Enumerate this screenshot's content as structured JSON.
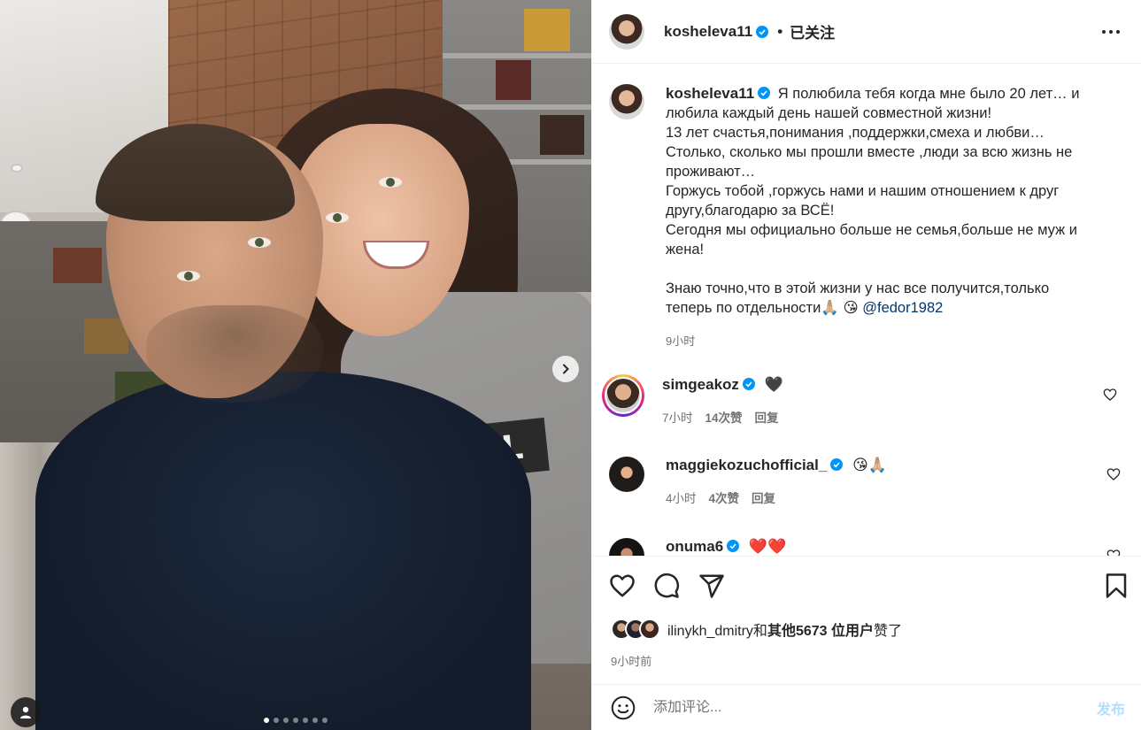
{
  "post": {
    "author": "kosheleva11",
    "follow_status": "已关注",
    "separator": "•",
    "carousel_count": 7,
    "carousel_active": 1
  },
  "caption": {
    "username": "kosheleva11",
    "lines": [
      "Я полюбила тебя когда мне было 20 лет… и",
      "любила каждый день нашей совместной жизни!",
      "13 лет счастья,понимания ,поддержки,смеха и любви…",
      "Столько, сколько мы прошли вместе ,люди за всю жизнь не",
      "проживают…",
      "Горжусь тобой ,горжусь нами и нашим отношением к друг",
      "другу,благодарю за ВСЁ!",
      "Сегодня мы официально больше не семья,больше не муж и",
      "жена!",
      "",
      "Знаю точно,что в этой жизни у нас все получится,только",
      "теперь по отдельности🙏🏼 😘 "
    ],
    "mention": "@fedor1982",
    "time": "9小时"
  },
  "comments": [
    {
      "username": "simgeakoz",
      "text": "🖤",
      "time": "7小时",
      "likes": "14次赞",
      "reply": "回复"
    },
    {
      "username": "maggiekozuchofficial_",
      "text": "😘🙏🏼",
      "time": "4小时",
      "likes": "4次赞",
      "reply": "回复"
    },
    {
      "username": "onuma6",
      "text": "❤️❤️",
      "time": "",
      "likes": "",
      "reply": ""
    }
  ],
  "likes": {
    "user": "ilinykh_dmitry",
    "connector": "和",
    "others": "其他5673 位用户",
    "suffix": "赞了"
  },
  "post_time": "9小时前",
  "comment_box": {
    "placeholder": "添加评论...",
    "post_label": "发布"
  },
  "colors": {
    "verified": "#0095f6",
    "mention": "#00376b",
    "muted": "#737373",
    "post_button": "#b2dffc"
  },
  "icons": [
    "verified-icon",
    "more-icon",
    "next-arrow-icon",
    "user-tag-icon",
    "heart-icon",
    "comment-icon",
    "share-icon",
    "bookmark-icon",
    "emoji-icon"
  ]
}
